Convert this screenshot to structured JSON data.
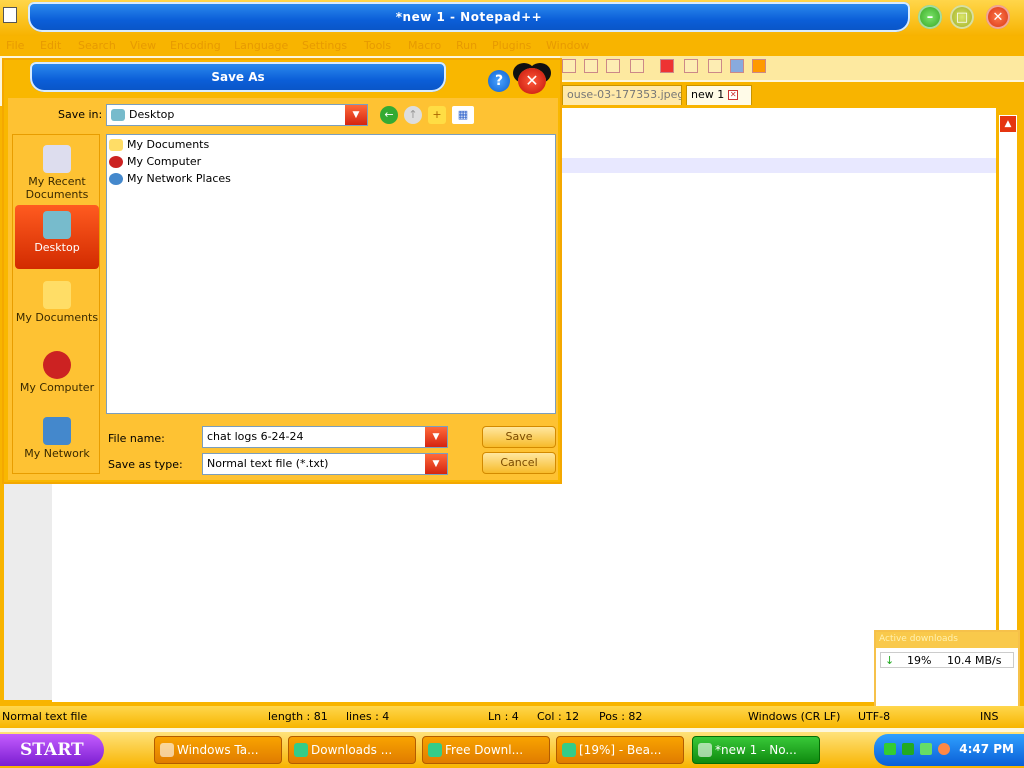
{
  "window": {
    "title": "*new 1 - Notepad++",
    "menu": [
      "File",
      "Edit",
      "Search",
      "View",
      "Encoding",
      "Language",
      "Settings",
      "Tools",
      "Macro",
      "Run",
      "Plugins",
      "Window"
    ]
  },
  "tabs": [
    {
      "label": "ouse-03-177353.jpeg",
      "active": false
    },
    {
      "label": "new 1",
      "active": true
    }
  ],
  "statusbar": {
    "file_type": "Normal text file",
    "length": "length : 81",
    "lines": "lines : 4",
    "ln": "Ln : 4",
    "col": "Col : 12",
    "pos": "Pos : 82",
    "eol": "Windows (CR LF)",
    "encoding": "UTF-8",
    "mode": "INS"
  },
  "downloads": {
    "title": "Active downloads",
    "progress": "19%",
    "speed": "10.4 MB/s"
  },
  "dialog": {
    "title": "Save As",
    "help_glyph": "?",
    "close_glyph": "✕",
    "save_in_label": "Save in:",
    "save_in_value": "Desktop",
    "places": [
      {
        "label": "My Recent Documents",
        "icon": "recent-documents-icon",
        "active": false
      },
      {
        "label": "Desktop",
        "icon": "desktop-icon",
        "active": true
      },
      {
        "label": "My Documents",
        "icon": "my-documents-icon",
        "active": false
      },
      {
        "label": "My Computer",
        "icon": "my-computer-icon",
        "active": false
      },
      {
        "label": "My Network",
        "icon": "network-icon",
        "active": false
      }
    ],
    "files": [
      {
        "name": "My Documents",
        "icon": "my-documents-icon"
      },
      {
        "name": "My Computer",
        "icon": "my-computer-icon"
      },
      {
        "name": "My Network Places",
        "icon": "network-places-icon"
      }
    ],
    "file_name_label": "File name:",
    "file_name_value": "chat logs 6-24-24",
    "save_type_label": "Save as type:",
    "save_type_value": "Normal text file (*.txt)",
    "save_button": "Save",
    "cancel_button": "Cancel"
  },
  "taskbar": {
    "start_label": "START",
    "tasks": [
      {
        "label": "Windows Ta...",
        "active": false
      },
      {
        "label": "Downloads ...",
        "active": false
      },
      {
        "label": "Free Downl...",
        "active": false
      },
      {
        "label": "[19%] - Bea...",
        "active": false
      },
      {
        "label": "*new 1 - No...",
        "active": true
      }
    ],
    "clock": "4:47 PM"
  },
  "colors": {
    "accent_orange": "#f8b400",
    "title_blue": "#0b5ed8",
    "danger_red": "#d42410",
    "task_active_green": "#0f8a0f"
  }
}
